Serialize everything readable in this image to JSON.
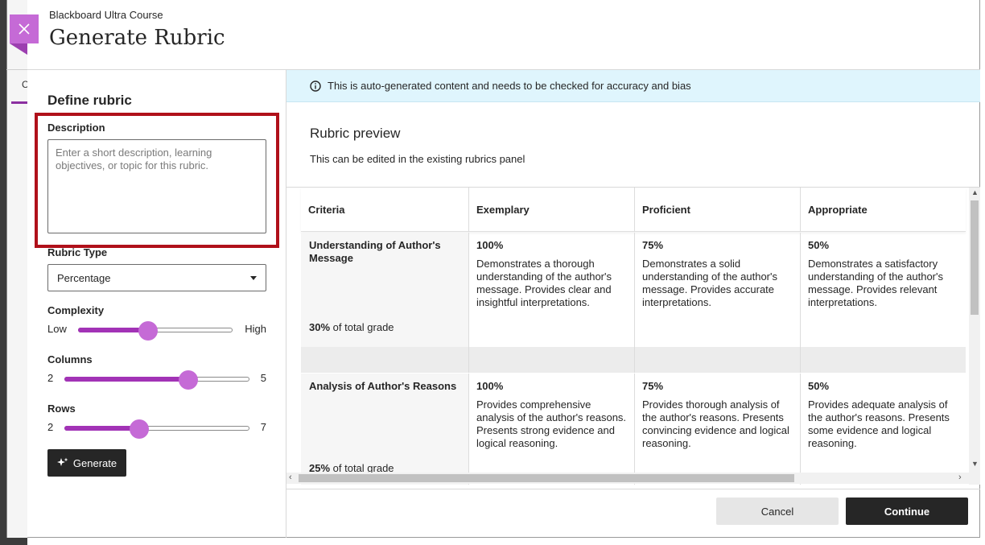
{
  "header": {
    "subtitle": "Blackboard Ultra Course",
    "title": "Generate Rubric"
  },
  "background": {
    "tab_char": "C"
  },
  "left": {
    "section_title": "Define rubric",
    "description": {
      "label": "Description",
      "value": "",
      "placeholder": "Enter a short description, learning objectives, or topic for this rubric."
    },
    "rubric_type": {
      "label": "Rubric Type",
      "selected": "Percentage"
    },
    "complexity": {
      "label": "Complexity",
      "min_label": "Low",
      "max_label": "High",
      "level": 0.45
    },
    "columns": {
      "label": "Columns",
      "min": "2",
      "max": "5",
      "value": 4
    },
    "rows": {
      "label": "Rows",
      "min": "2",
      "max": "7",
      "value": 4
    },
    "generate_label": "Generate"
  },
  "right": {
    "notice": "This is auto-generated content and needs to be checked for accuracy and bias",
    "preview_title": "Rubric preview",
    "preview_sub": "This can be edited in the existing rubrics panel",
    "table": {
      "headers": [
        "Criteria",
        "Exemplary",
        "Proficient",
        "Appropriate"
      ],
      "rows": [
        {
          "criterion": "Understanding of Author's Message",
          "weight_pct": "30%",
          "weight_suffix": " of total grade",
          "cells": [
            {
              "pct": "100%",
              "text": "Demonstrates a thorough understanding of the author's message. Provides clear and insightful interpretations."
            },
            {
              "pct": "75%",
              "text": "Demonstrates a solid understanding of the author's message. Provides accurate interpretations."
            },
            {
              "pct": "50%",
              "text": "Demonstrates a satisfactory understanding of the author's message. Provides relevant interpretations."
            }
          ]
        },
        {
          "criterion": "Analysis of Author's Reasons",
          "weight_pct": "25%",
          "weight_suffix": " of total grade",
          "cells": [
            {
              "pct": "100%",
              "text": "Provides comprehensive analysis of the author's reasons. Presents strong evidence and logical reasoning."
            },
            {
              "pct": "75%",
              "text": "Provides thorough analysis of the author's reasons. Presents convincing evidence and logical reasoning."
            },
            {
              "pct": "50%",
              "text": "Provides adequate analysis of the author's reasons. Presents some evidence and logical reasoning."
            }
          ]
        }
      ]
    }
  },
  "footer": {
    "cancel_label": "Cancel",
    "continue_label": "Continue"
  },
  "colors": {
    "accent": "#a233b6",
    "thumb": "#c56ad6",
    "highlight": "#b0101a",
    "notice_bg": "#dff5fd",
    "dark_button": "#262626"
  },
  "icons": {
    "close": "close-icon",
    "info": "info-icon",
    "sparkle": "sparkle-icon",
    "caret": "chevron-down-icon"
  }
}
